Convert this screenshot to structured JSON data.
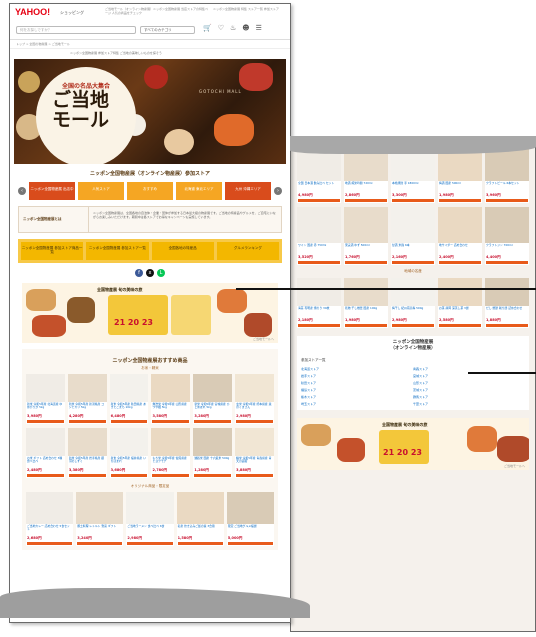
{
  "header": {
    "logo": "YAHOO!",
    "logo_sub": "ショッピング",
    "promo_left": "ご当地モール（オンライン物産展）ニッポン全国物産展 当店ストアの特集ページ 人気の商品をチェック",
    "promo_right": "ニッポン全国物産展 特集 ストア一覧 参加ストア",
    "search_placeholder": "何をお探しですか？",
    "category": "すべてのカテゴリ",
    "icon_names": [
      "cart-icon",
      "heart-icon",
      "bell-icon",
      "user-icon",
      "menu-icon"
    ]
  },
  "breadcrumb": "トップ > 全国の物産展 > ご当地モール",
  "breadcrumb2": "ニッポン全国物産展 参加ストア特集 ご当地の美味しいものを探そう",
  "hero": {
    "tag": "全国の名品大集合",
    "title_line1": "ご当地",
    "title_line2": "モール",
    "sub": "GOTOCHI MALL"
  },
  "store_section": {
    "title": "ニッポン全国物産展（オンライン物産展）参加ストア",
    "chips": [
      "ニッポン全国物産展 出店中",
      "人気ストア",
      "おすすめ",
      "北海道 東北エリア",
      "九州 沖縄エリア"
    ],
    "desc_heading": "ニッポン全国物産展とは",
    "desc_body": "ニッポン全国物産展は、全国各地の自治体・企業・団体が参加する日本最大級の物産展です。ご当地の特産品やグルメを、ご自宅にいながらお楽しみいただけます。期間中は各ストアでお得なキャンペーンも実施しています。"
  },
  "tabs": [
    "ニッポン全国物産展 参加ストア商品一覧",
    "ニッポン全国物産展 参加ストア一覧",
    "全国各地の特産品",
    "グルメランキング"
  ],
  "banner": {
    "title": "全国物産展 旬の美味の旅",
    "dates": "21 20 23",
    "note": "ご当地モールへ"
  },
  "recommend": {
    "title": "ニッポン全国物産展おすすめ商品",
    "sub1": "お米・精米",
    "sub2": "オリジナル商品・限定品",
    "products_a": [
      {
        "name": "新米 令和5年産 北海道産 ゆめぴりか 5kg",
        "price": "3,980円"
      },
      {
        "name": "新米 令和5年産 新潟県産 コシヒカリ 5kg",
        "price": "4,280円"
      },
      {
        "name": "新米 令和5年産 秋田県産 あきたこまち 10kg",
        "price": "6,480円"
      },
      {
        "name": "無洗米 令和5年産 山形県産 つや姫 5kg",
        "price": "3,580円"
      },
      {
        "name": "新米 令和5年産 宮城県産 ひとめぼれ 5kg",
        "price": "3,280円"
      },
      {
        "name": "玄米 令和5年産 熊本県産 森のくまさん",
        "price": "2,980円"
      }
    ],
    "products_b": [
      {
        "name": "お米 ギフト 詰め合わせ 3種 食べ比べ",
        "price": "2,480円"
      },
      {
        "name": "新米 令和5年産 岩手県産 銀河のしずく",
        "price": "3,380円"
      },
      {
        "name": "新米 令和5年産 福井県産 いちほまれ",
        "price": "3,680円"
      },
      {
        "name": "もち米 令和5年産 佐賀県産 ヒヨクモチ",
        "price": "2,780円"
      },
      {
        "name": "雑穀米 国産 十六穀米 500g",
        "price": "1,280円"
      },
      {
        "name": "精米 令和5年産 青森県産 青天の霹靂",
        "price": "3,880円"
      }
    ],
    "products_c": [
      {
        "name": "ご当地カレー 詰め合わせ 5食セット",
        "price": "2,680円"
      },
      {
        "name": "郷土料理 レトルト 惣菜 ギフト",
        "price": "3,240円"
      },
      {
        "name": "ご当地ラーメン 食べ比べ 6食",
        "price": "2,980円"
      },
      {
        "name": "名産 炊き込みご飯の素 3合用",
        "price": "1,580円"
      },
      {
        "name": "限定 ご当地グルメ福袋",
        "price": "5,000円"
      }
    ]
  },
  "right_page": {
    "row1": [
      {
        "name": "全国 日本酒 飲み比べ セット",
        "price": "4,980円"
      },
      {
        "name": "地酒 純米吟醸 720ml",
        "price": "2,860円"
      },
      {
        "name": "本格焼酎 芋 1800ml",
        "price": "3,300円"
      },
      {
        "name": "梅酒 国産 500ml",
        "price": "1,980円"
      },
      {
        "name": "クラフトビール 6本セット",
        "price": "3,960円"
      }
    ],
    "row2": [
      {
        "name": "ワイン 国産 赤 750ml",
        "price": "3,520円"
      },
      {
        "name": "果実酒 ゆず 500ml",
        "price": "1,760円"
      },
      {
        "name": "甘酒 米麹 6本",
        "price": "2,160円"
      },
      {
        "name": "地サイダー 詰め合わせ",
        "price": "2,400円"
      },
      {
        "name": "クラフトジン 700ml",
        "price": "4,400円"
      }
    ],
    "section2": "地域の名産",
    "row3": [
      {
        "name": "海苔 有明産 焼のり 30枚",
        "price": "2,180円"
      },
      {
        "name": "乾物 干し椎茸 国産 100g",
        "price": "1,980円"
      },
      {
        "name": "梅干し 紀州南高梅 500g",
        "price": "2,980円"
      },
      {
        "name": "お茶 静岡 深蒸し茶 3袋",
        "price": "2,580円"
      },
      {
        "name": "だし 鰹節 削り節 詰め合わせ",
        "price": "1,880円"
      }
    ],
    "footer_title": "ニッポン全国物産展",
    "footer_sub": "（オンライン物産展）",
    "footer_heading": "参加ストア一覧",
    "footer_links": [
      "北海道ストア",
      "青森ストア",
      "岩手ストア",
      "宮城ストア",
      "秋田ストア",
      "山形ストア",
      "福島ストア",
      "茨城ストア",
      "栃木ストア",
      "群馬ストア",
      "埼玉ストア",
      "千葉ストア"
    ]
  },
  "colors": {
    "accent": "#d94c1c",
    "yellow": "#f3b700",
    "bg": "#f5f1ec"
  }
}
